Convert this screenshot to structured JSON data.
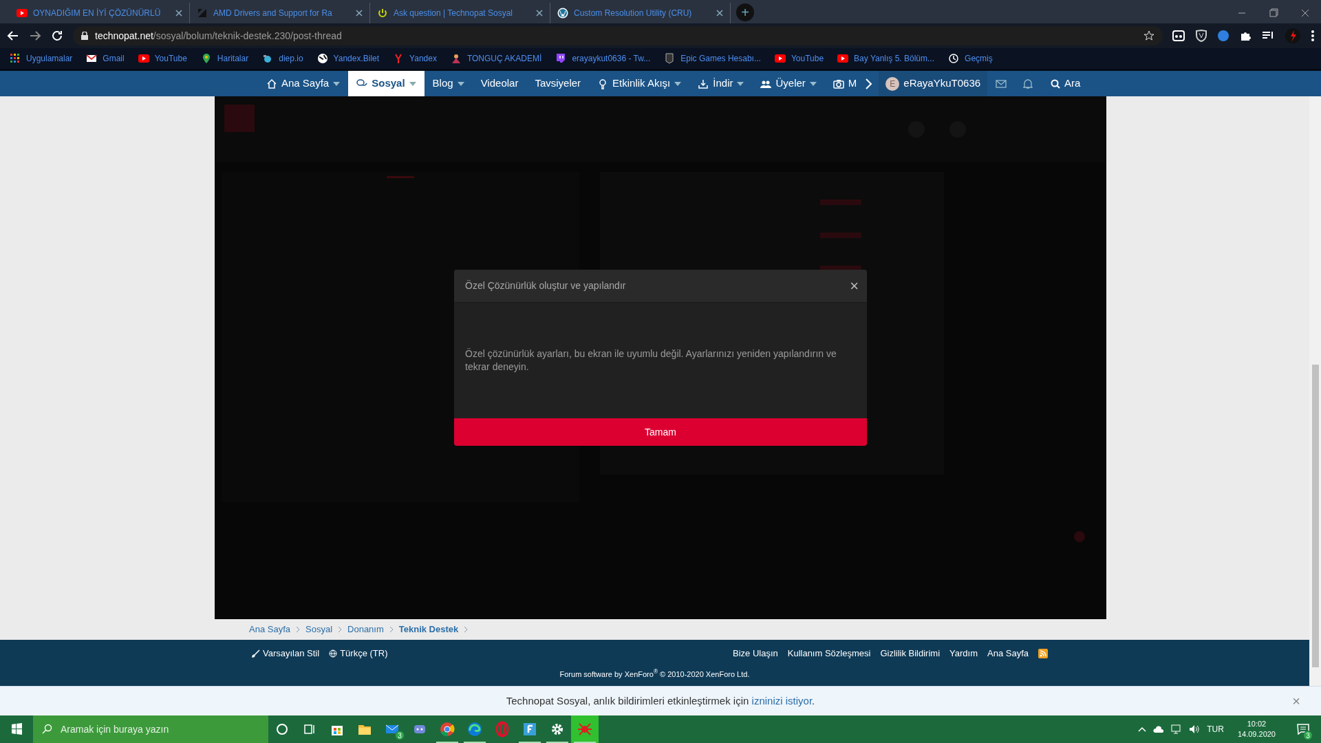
{
  "browser": {
    "tabs": [
      {
        "title": "OYNADIĞIM EN İYİ ÇÖZÜNÜRLÜ"
      },
      {
        "title": "AMD Drivers and Support for Ra"
      },
      {
        "title": "Ask question | Technopat Sosyal"
      },
      {
        "title": "Custom Resolution Utility (CRU)"
      }
    ],
    "new_tab": "+",
    "url_host": "technopat.net",
    "url_path": "/sosyal/bolum/teknik-destek.230/post-thread",
    "bookmarks": [
      "Uygulamalar",
      "Gmail",
      "YouTube",
      "Haritalar",
      "diep.io",
      "Yandex.Bilet",
      "Yandex",
      "TONGUÇ AKADEMİ",
      "erayaykut0636 - Tw...",
      "Epic Games Hesabı...",
      "YouTube",
      "Bay Yanlış 5. Bölüm...",
      "Geçmiş"
    ]
  },
  "nav": {
    "items": [
      {
        "label": "Ana Sayfa",
        "selected": false,
        "dropdown": true
      },
      {
        "label": "Sosyal",
        "selected": true,
        "dropdown": true
      },
      {
        "label": "Blog",
        "selected": false,
        "dropdown": true
      },
      {
        "label": "Videolar",
        "selected": false,
        "dropdown": false
      },
      {
        "label": "Tavsiyeler",
        "selected": false,
        "dropdown": false
      },
      {
        "label": "Etkinlik Akışı",
        "selected": false,
        "dropdown": true
      },
      {
        "label": "İndir",
        "selected": false,
        "dropdown": true
      },
      {
        "label": "Üyeler",
        "selected": false,
        "dropdown": true
      },
      {
        "label": "M",
        "selected": false,
        "dropdown": false
      }
    ],
    "avatar_letter": "E",
    "username": "eRayaYkuT0636",
    "search": "Ara"
  },
  "content": {
    "kind": "picture"
  },
  "dialog": {
    "title": "Özel Çözünürlük oluştur ve yapılandır",
    "close": "×",
    "message": "Özel çözünürlük ayarları, bu ekran ile uyumlu değil. Ayarlarınızı yeniden yapılandırın ve tekrar deneyin.",
    "button": "Tamam"
  },
  "breadcrumb": [
    "Ana Sayfa",
    "Sosyal",
    "Donanım",
    "Teknik Destek"
  ],
  "footer": {
    "left": [
      "Varsayılan Stil",
      "Türkçe (TR)"
    ],
    "right": [
      "Bize Ulaşın",
      "Kullanım Sözleşmesi",
      "Gizlilik Bildirimi",
      "Yardım",
      "Ana Sayfa"
    ],
    "copyright": "Forum software by XenForo$^{®}$ © 2010-2020 XenForo Ltd."
  },
  "notice": {
    "text": "Technopat Sosyal, anlık bildirimleri etkinleştirmek için ",
    "link": "izninizi istiyor",
    "end": ".",
    "close": "×"
  },
  "taskbar": {
    "search": {
      "placeholder": "Aramak için buraya yazın"
    },
    "apps": [
      {
        "running": false,
        "selected": false
      },
      {
        "running": false,
        "selected": false
      },
      {
        "running": false,
        "selected": false
      },
      {
        "running": false,
        "selected": false
      },
      {
        "running": false,
        "selected": false,
        "badge": "3"
      },
      {
        "running": false,
        "selected": false
      },
      {
        "running": true,
        "selected": false
      },
      {
        "running": true,
        "selected": false
      },
      {
        "running": false,
        "selected": false
      },
      {
        "running": true,
        "selected": false
      },
      {
        "running": true,
        "selected": false
      },
      {
        "running": true,
        "selected": true
      }
    ],
    "language": "TUR",
    "time": "10:02",
    "date": "14.09.2020",
    "notifications": "3"
  }
}
